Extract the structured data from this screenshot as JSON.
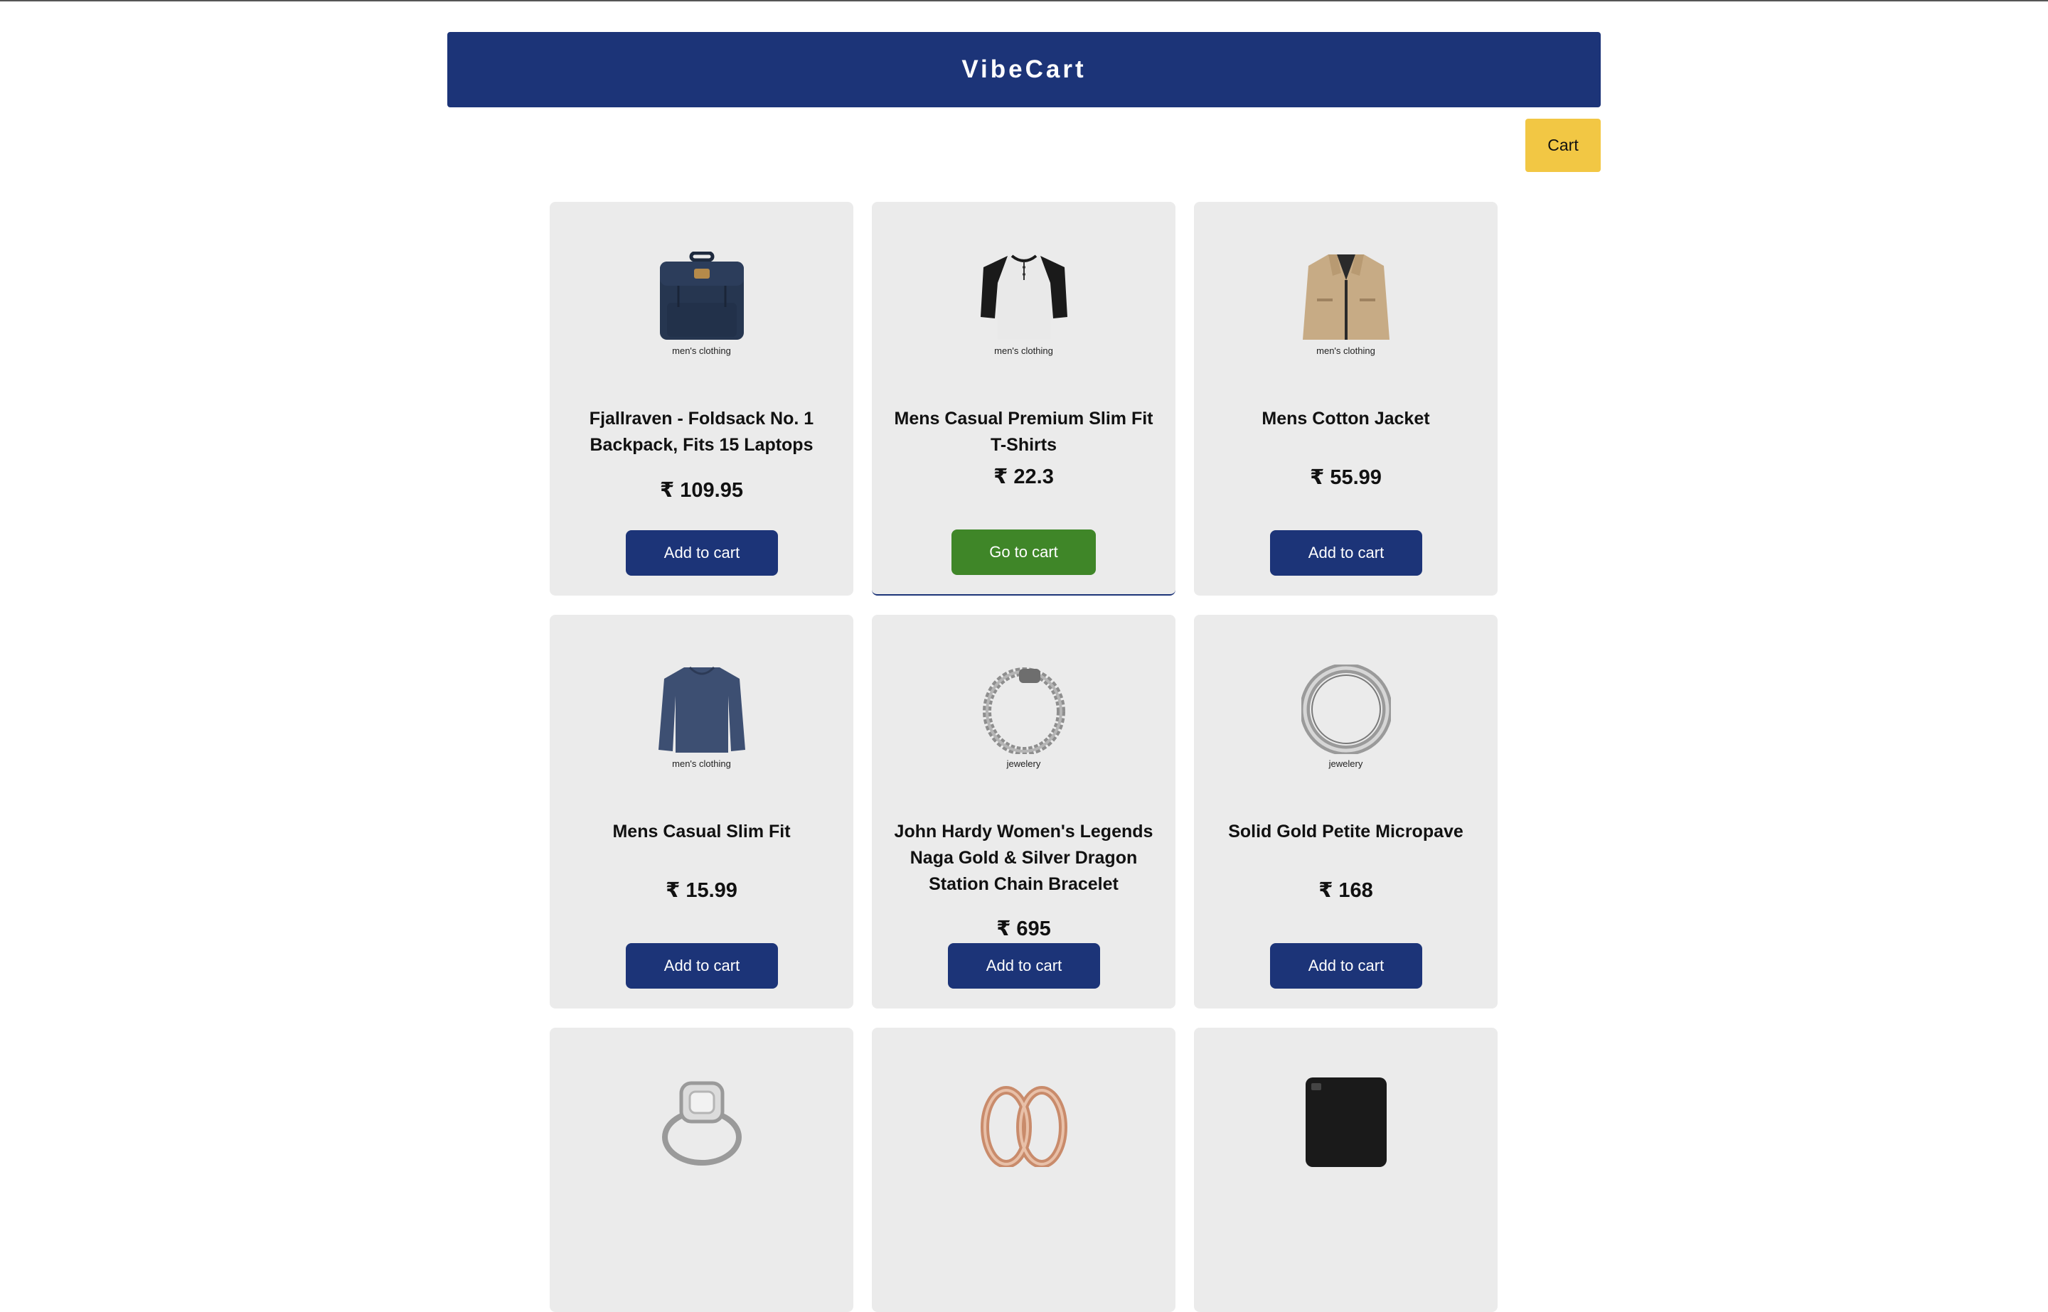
{
  "header": {
    "brand": "VibeCart"
  },
  "cart_button": {
    "label": "Cart"
  },
  "currency": "₹",
  "products": [
    {
      "title": "Fjallraven - Foldsack No. 1 Backpack, Fits 15 Laptops",
      "price": "₹ 109.95",
      "category": "men's clothing",
      "button": "Add to cart",
      "icon": "backpack-image"
    },
    {
      "title": "Mens Casual Premium Slim Fit T-Shirts",
      "price": "₹ 22.3",
      "category": "men's clothing",
      "button": "Go to cart",
      "icon": "tshirt-image"
    },
    {
      "title": "Mens Cotton Jacket",
      "price": "₹ 55.99",
      "category": "men's clothing",
      "button": "Add to cart",
      "icon": "jacket-image"
    },
    {
      "title": "Mens Casual Slim Fit",
      "price": "₹ 15.99",
      "category": "men's clothing",
      "button": "Add to cart",
      "icon": "longsleeve-image"
    },
    {
      "title": "John Hardy Women's Legends Naga Gold & Silver Dragon Station Chain Bracelet",
      "price": "₹ 695",
      "category": "jewelery",
      "button": "Add to cart",
      "icon": "bracelet-image"
    },
    {
      "title": "Solid Gold Petite Micropave",
      "price": "₹ 168",
      "category": "jewelery",
      "button": "Add to cart",
      "icon": "ring-image"
    },
    {
      "icon": "diamond-ring-image"
    },
    {
      "icon": "rose-gold-rings-image"
    },
    {
      "icon": "hard-drive-image"
    }
  ],
  "colors": {
    "header_bg": "#1c3478",
    "cart_bg": "#f2c744",
    "card_bg": "#ebebeb",
    "add_button": "#1c3478",
    "go_button": "#3f8628"
  }
}
